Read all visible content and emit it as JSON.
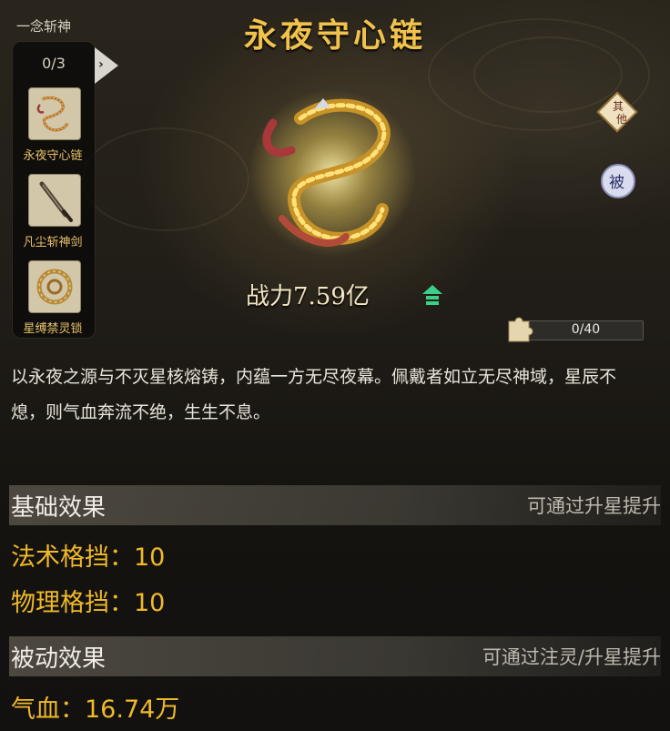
{
  "header": {
    "category": "一念斩神",
    "title": "永夜守心链"
  },
  "side_panel": {
    "count": "0/3",
    "items": [
      {
        "label": "永夜守心链",
        "icon": "chain-icon"
      },
      {
        "label": "凡尘斩神剑",
        "icon": "sword-icon"
      },
      {
        "label": "星缚禁灵锁",
        "icon": "lock-ring-icon"
      }
    ]
  },
  "item": {
    "power_label": "战力7.59亿",
    "shard_progress": "0/40",
    "description": "以永夜之源与不灭星核熔铸，内蕴一方无尽夜幕。佩戴者如立无尽神域，星辰不熄，则气血奔流不绝，生生不息。"
  },
  "buttons": {
    "other": "其他",
    "passive": "被"
  },
  "basic_effects": {
    "title": "基础效果",
    "hint": "可通过升星提升",
    "stats": [
      "法术格挡：10",
      "物理格挡：10"
    ]
  },
  "passive_effects": {
    "title": "被动效果",
    "hint": "可通过注灵/升星提升",
    "stats": [
      "气血：16.74万"
    ]
  },
  "colors": {
    "title": "#f1c34c",
    "stat": "#f0b92a",
    "label": "#e8c36a",
    "up": "#3ccf8a"
  }
}
